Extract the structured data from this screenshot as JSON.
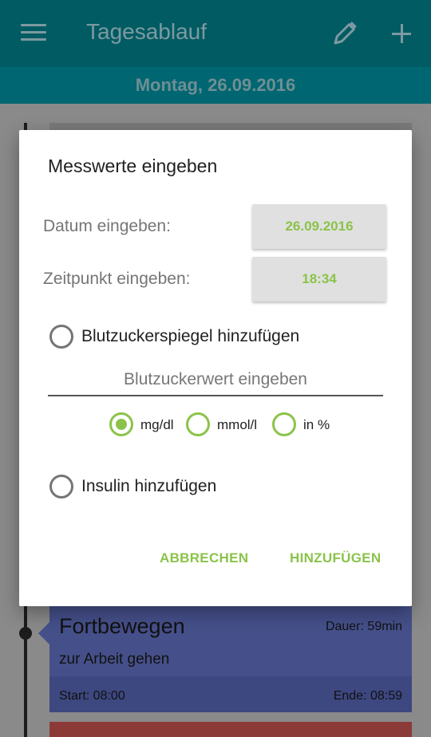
{
  "appbar": {
    "title": "Tagesablauf",
    "menu_icon": "hamburger-menu-icon",
    "edit_icon": "pencil-icon",
    "add_icon": "plus-icon"
  },
  "datebar": {
    "date": "Montag, 26.09.2016"
  },
  "dialog": {
    "title": "Messwerte eingeben",
    "date_label": "Datum eingeben:",
    "date_value": "26.09.2016",
    "time_label": "Zeitpunkt eingeben:",
    "time_value": "18:34",
    "blood_sugar_option": "Blutzuckerspiegel hinzufügen",
    "blood_sugar_placeholder": "Blutzuckerwert eingeben",
    "units": [
      {
        "label": "mg/dl",
        "selected": true
      },
      {
        "label": "mmol/l",
        "selected": false
      },
      {
        "label": "in %",
        "selected": false
      }
    ],
    "insulin_option": "Insulin hinzufügen",
    "cancel_label": "ABBRECHEN",
    "add_label": "HINZUFÜGEN"
  },
  "activity_card": {
    "title": "Fortbewegen",
    "duration": "Dauer: 59min",
    "subtitle": "zur Arbeit gehen",
    "start": "Start: 08:00",
    "end": "Ende: 08:59"
  },
  "colors": {
    "accent": "#8bc34a",
    "appbar": "#005b63",
    "card_blue": "#45508a"
  }
}
